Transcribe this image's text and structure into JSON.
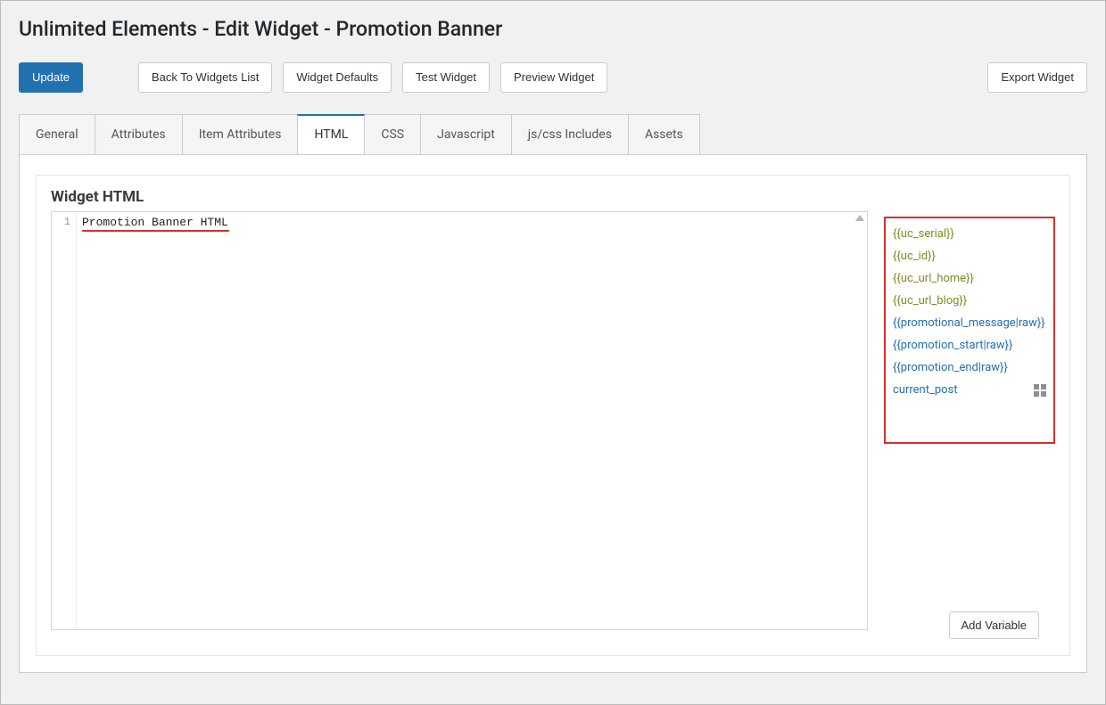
{
  "page": {
    "title": "Unlimited Elements - Edit Widget - Promotion Banner"
  },
  "toolbar": {
    "update": "Update",
    "back": "Back To Widgets List",
    "defaults": "Widget Defaults",
    "test": "Test Widget",
    "preview": "Preview Widget",
    "export": "Export Widget"
  },
  "tabs": {
    "general": "General",
    "attributes": "Attributes",
    "item_attributes": "Item Attributes",
    "html": "HTML",
    "css": "CSS",
    "javascript": "Javascript",
    "includes": "js/css Includes",
    "assets": "Assets"
  },
  "panel": {
    "title": "Widget HTML",
    "gutter_line": "1",
    "code_line": "Promotion Banner HTML",
    "add_variable": "Add Variable"
  },
  "variables": {
    "uc_serial": "{{uc_serial}}",
    "uc_id": "{{uc_id}}",
    "uc_url_home": "{{uc_url_home}}",
    "uc_url_blog": "{{uc_url_blog}}",
    "promotional_message": "{{promotional_message|raw}}",
    "promotion_start": "{{promotion_start|raw}}",
    "promotion_end": "{{promotion_end|raw}}",
    "current_post": "current_post"
  }
}
